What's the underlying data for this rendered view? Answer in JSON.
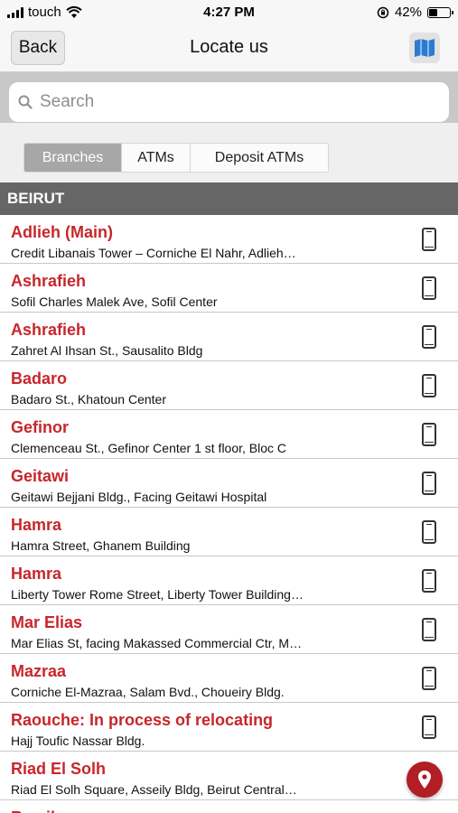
{
  "status_bar": {
    "carrier": "touch",
    "time": "4:27 PM",
    "battery": "42%",
    "battery_level": 0.42
  },
  "nav": {
    "back_label": "Back",
    "title": "Locate us"
  },
  "search": {
    "placeholder": "Search"
  },
  "tabs": [
    {
      "label": "Branches",
      "active": true
    },
    {
      "label": "ATMs",
      "active": false
    },
    {
      "label": "Deposit ATMs",
      "active": false
    }
  ],
  "section": {
    "title": "BEIRUT"
  },
  "branches": [
    {
      "name": "Adlieh (Main)",
      "address": "Credit Libanais Tower – Corniche El Nahr, Adlieh…"
    },
    {
      "name": "Ashrafieh",
      "address": "Sofil Charles Malek Ave, Sofil Center"
    },
    {
      "name": "Ashrafieh",
      "address": "Zahret Al Ihsan St., Sausalito Bldg"
    },
    {
      "name": "Badaro",
      "address": "Badaro St., Khatoun Center"
    },
    {
      "name": "Gefinor",
      "address": "Clemenceau St., Gefinor Center 1 st floor, Bloc C"
    },
    {
      "name": "Geitawi",
      "address": "Geitawi Bejjani Bldg., Facing Geitawi Hospital"
    },
    {
      "name": "Hamra",
      "address": "Hamra Street, Ghanem Building"
    },
    {
      "name": "Hamra",
      "address": "Liberty Tower Rome Street, Liberty Tower Building…"
    },
    {
      "name": "Mar Elias",
      "address": "Mar Elias St, facing Makassed Commercial Ctr, M…"
    },
    {
      "name": "Mazraa",
      "address": "Corniche El-Mazraa, Salam Bvd., Choueiry Bldg."
    },
    {
      "name": "Raouche: In process of relocating",
      "address": "Hajj Toufic Nassar Bldg."
    },
    {
      "name": "Riad El Solh",
      "address": "Riad El Solh Square, Asseily Bldg, Beirut Central…"
    },
    {
      "name": "Rmeil",
      "address": ""
    }
  ],
  "icons": {
    "wifi": "wifi-icon",
    "rotation_lock": "rotation-lock-icon",
    "battery": "battery-icon",
    "map": "map-icon",
    "search": "search-icon",
    "phone": "phone-icon",
    "location": "location-pin-icon"
  },
  "colors": {
    "accent_red": "#c8262b",
    "section_bg": "#666666",
    "map_blue": "#2a7bd1"
  }
}
